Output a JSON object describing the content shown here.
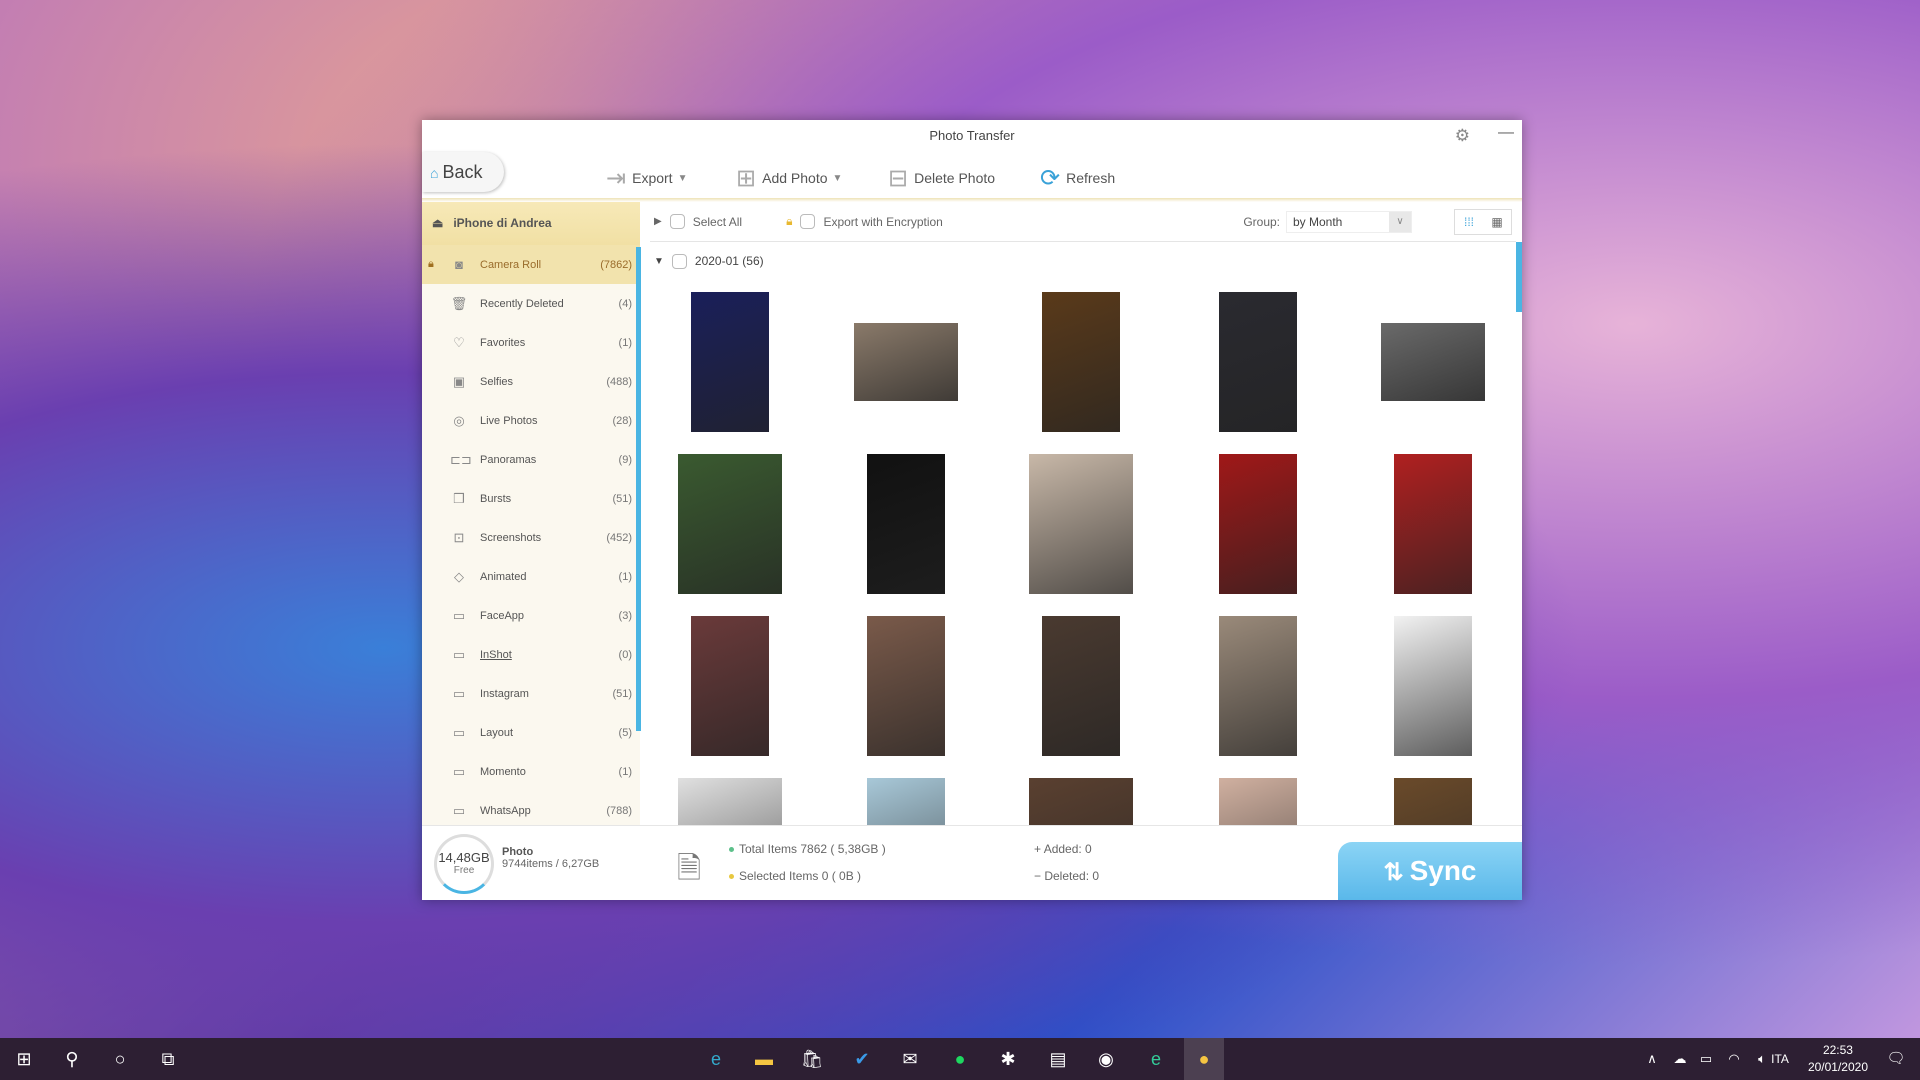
{
  "window": {
    "title": "Photo Transfer"
  },
  "toolbar": {
    "back": "Back",
    "export": "Export",
    "add_photo": "Add Photo",
    "delete_photo": "Delete Photo",
    "refresh": "Refresh"
  },
  "sidebar": {
    "device": "iPhone di Andrea",
    "items": [
      {
        "label": "Camera Roll",
        "count": "(7862)",
        "icon": "camera-icon",
        "glyph": "◙"
      },
      {
        "label": "Recently Deleted",
        "count": "(4)",
        "icon": "trash-icon",
        "glyph": "🗑"
      },
      {
        "label": "Favorites",
        "count": "(1)",
        "icon": "heart-icon",
        "glyph": "♡"
      },
      {
        "label": "Selfies",
        "count": "(488)",
        "icon": "selfie-icon",
        "glyph": "▣"
      },
      {
        "label": "Live Photos",
        "count": "(28)",
        "icon": "live-photo-icon",
        "glyph": "◎"
      },
      {
        "label": "Panoramas",
        "count": "(9)",
        "icon": "panorama-icon",
        "glyph": "⊏⊐"
      },
      {
        "label": "Bursts",
        "count": "(51)",
        "icon": "bursts-icon",
        "glyph": "❒"
      },
      {
        "label": "Screenshots",
        "count": "(452)",
        "icon": "screenshot-icon",
        "glyph": "⊡"
      },
      {
        "label": "Animated",
        "count": "(1)",
        "icon": "animated-icon",
        "glyph": "◇"
      },
      {
        "label": "FaceApp",
        "count": "(3)",
        "icon": "album-icon",
        "glyph": "▭"
      },
      {
        "label": "InShot",
        "count": "(0)",
        "icon": "album-icon",
        "glyph": "▭"
      },
      {
        "label": "Instagram",
        "count": "(51)",
        "icon": "album-icon",
        "glyph": "▭"
      },
      {
        "label": "Layout",
        "count": "(5)",
        "icon": "album-icon",
        "glyph": "▭"
      },
      {
        "label": "Momento",
        "count": "(1)",
        "icon": "album-icon",
        "glyph": "▭"
      },
      {
        "label": "WhatsApp",
        "count": "(788)",
        "icon": "album-icon",
        "glyph": "▭"
      }
    ]
  },
  "options": {
    "select_all": "Select All",
    "export_encryption": "Export with Encryption",
    "group_label": "Group:",
    "group_value": "by Month"
  },
  "month": {
    "label": "2020-01 (56)"
  },
  "thumbnails": [
    {
      "shape": "portrait",
      "color": "#1a1f5a"
    },
    {
      "shape": "landscape",
      "color": "#8a7a6a"
    },
    {
      "shape": "portrait",
      "color": "#5a3a1a"
    },
    {
      "shape": "portrait",
      "color": "#2a2a30"
    },
    {
      "shape": "landscape",
      "color": "#6a6a6a"
    },
    {
      "shape": "landscape",
      "color": "#3a5a30"
    },
    {
      "shape": "portrait",
      "color": "#111111"
    },
    {
      "shape": "landscape",
      "color": "#c8b8a8"
    },
    {
      "shape": "portrait",
      "color": "#a01818"
    },
    {
      "shape": "portrait",
      "color": "#b02020"
    },
    {
      "shape": "portrait",
      "color": "#6a3a3a"
    },
    {
      "shape": "portrait",
      "color": "#7a5a4a"
    },
    {
      "shape": "portrait",
      "color": "#4a3a30"
    },
    {
      "shape": "portrait",
      "color": "#9a8a7a"
    },
    {
      "shape": "portrait",
      "color": "#f2f2f2"
    },
    {
      "shape": "landscape",
      "color": "#e0e0e0"
    },
    {
      "shape": "portrait",
      "color": "#a8c8d8"
    },
    {
      "shape": "landscape",
      "color": "#5a4030"
    },
    {
      "shape": "portrait",
      "color": "#d0b0a0"
    },
    {
      "shape": "portrait",
      "color": "#6a4a2a"
    }
  ],
  "storage": {
    "free": "14,48GB",
    "free_label": "Free",
    "category": "Photo",
    "usage": "9744items / 6,27GB"
  },
  "status": {
    "total": "Total Items 7862 ( 5,38GB )",
    "selected": "Selected Items 0 ( 0B )",
    "added": "Added: 0",
    "deleted": "Deleted: 0",
    "total_dot": "#5cc08a",
    "selected_dot": "#e8c840"
  },
  "sync": "Sync",
  "taskbar": {
    "time": "22:53",
    "date": "20/01/2020",
    "lang": "ITA"
  },
  "colors": {
    "accent": "#4ab5e3",
    "gold": "#f2e3ad"
  }
}
